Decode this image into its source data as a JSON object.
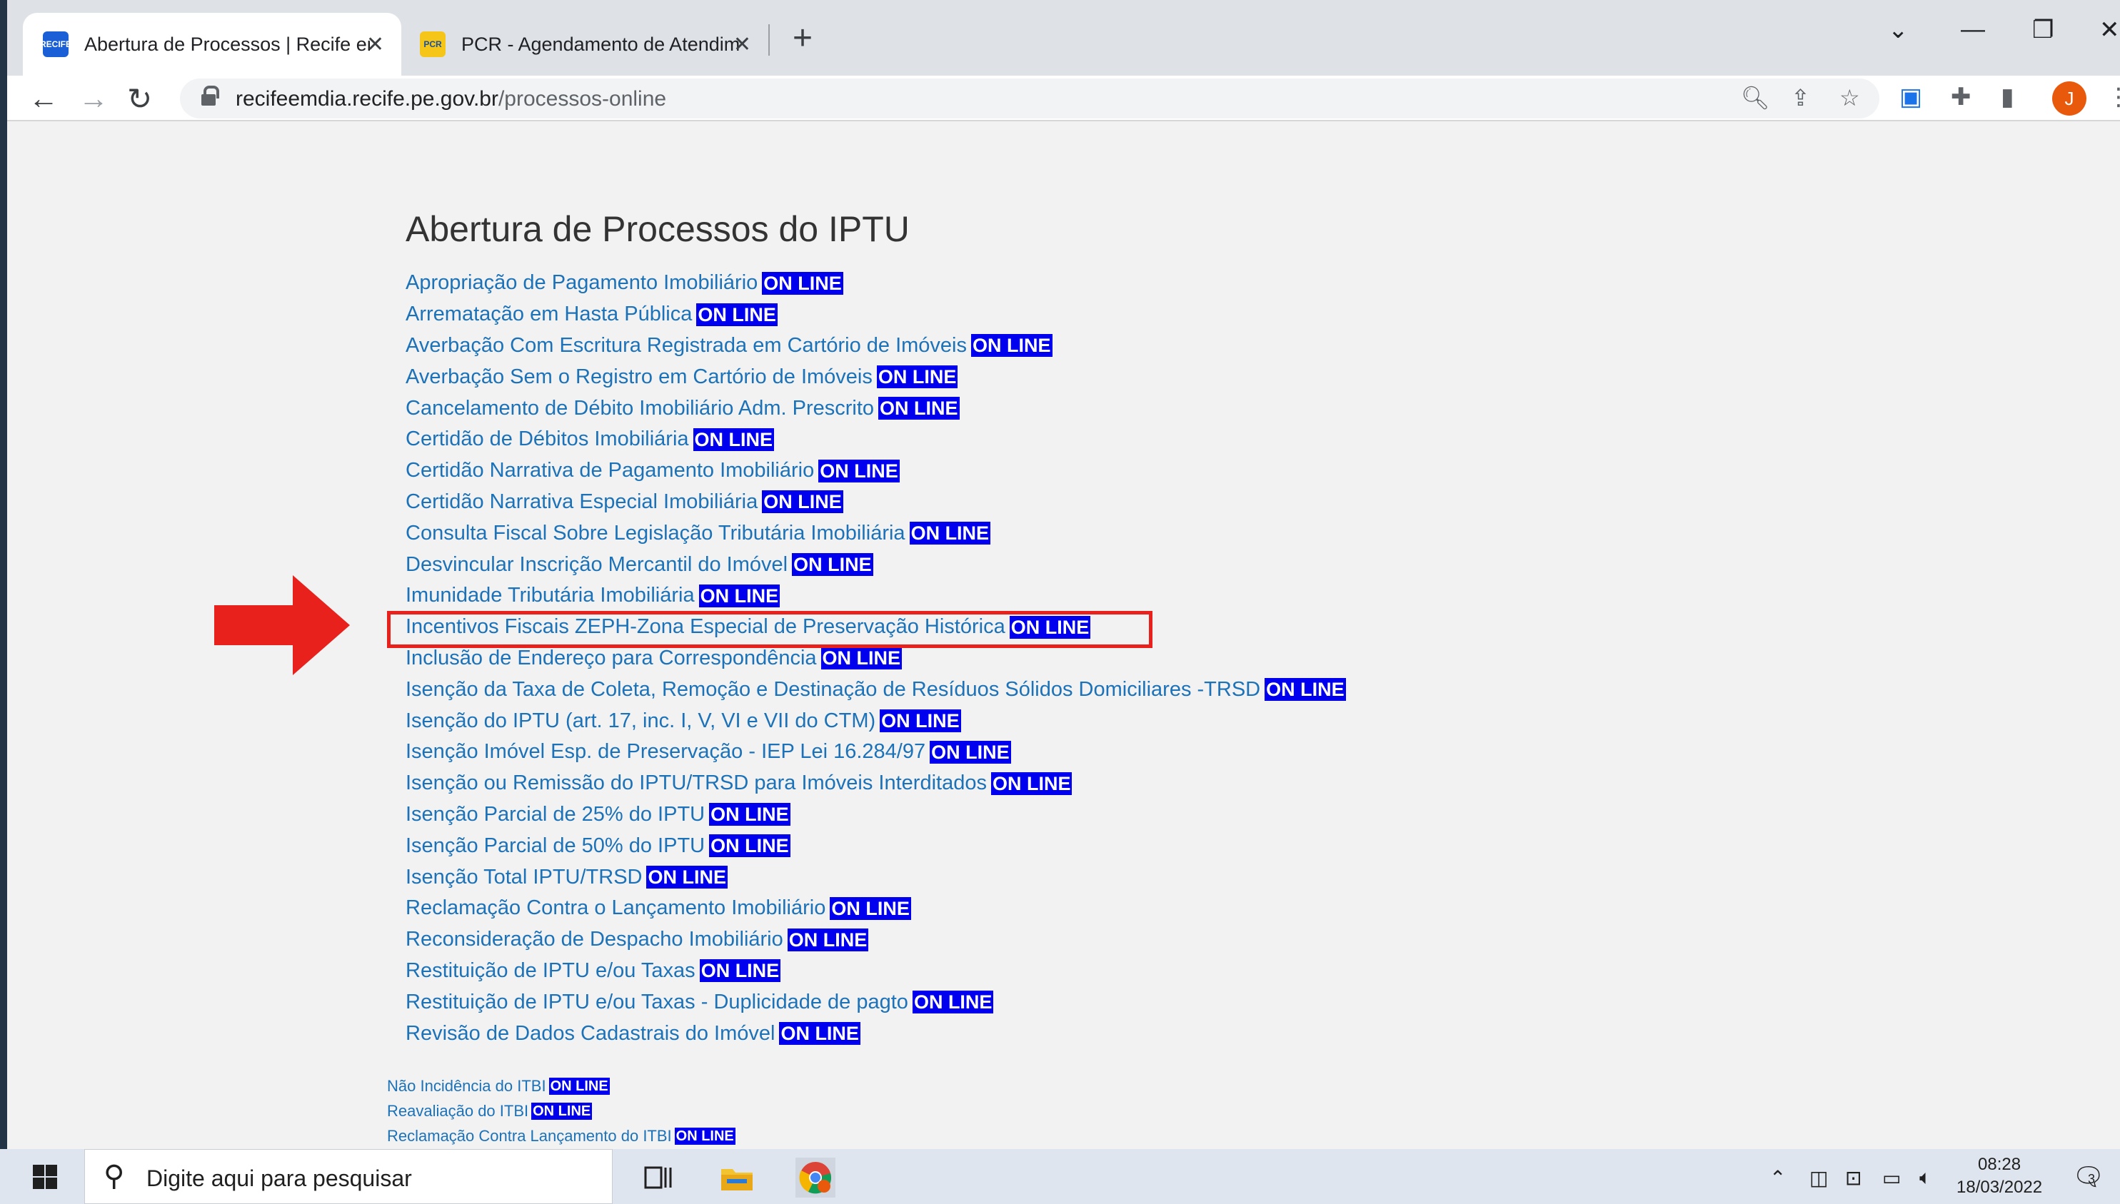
{
  "browser": {
    "tabs": [
      {
        "title": "Abertura de Processos | Recife em",
        "active": true,
        "icon": "recife-favicon"
      },
      {
        "title": "PCR - Agendamento de Atendim",
        "active": false,
        "icon": "pcr-favicon"
      }
    ],
    "url_host": "recifeemdia.recife.pe.gov.br",
    "url_path": "/processos-online",
    "profile_initial": "J"
  },
  "page": {
    "title": "Abertura de Processos do IPTU",
    "badge_label": "ON LINE",
    "iptu_items": [
      "Apropriação de Pagamento Imobiliário",
      "Arrematação em Hasta Pública",
      "Averbação Com Escritura Registrada em Cartório de Imóveis",
      "Averbação Sem o Registro em Cartório de Imóveis",
      "Cancelamento de Débito Imobiliário Adm. Prescrito",
      "Certidão de Débitos Imobiliária",
      "Certidão Narrativa de Pagamento Imobiliário",
      "Certidão Narrativa Especial Imobiliária",
      "Consulta Fiscal Sobre Legislação Tributária Imobiliária",
      "Desvincular Inscrição Mercantil do Imóvel",
      "Imunidade Tributária Imobiliária",
      "Incentivos Fiscais ZEPH-Zona Especial de Preservação Histórica",
      "Inclusão de Endereço para Correspondência",
      "Isenção da Taxa de Coleta, Remoção e Destinação de Resíduos Sólidos Domiciliares -TRSD",
      "Isenção do IPTU (art. 17, inc. I, V, VI e VII do CTM)",
      "Isenção Imóvel Esp. de Preservação - IEP Lei 16.284/97",
      "Isenção ou Remissão do IPTU/TRSD para Imóveis Interditados",
      "Isenção Parcial de 25% do IPTU",
      "Isenção Parcial de 50% do IPTU",
      "Isenção Total IPTU/TRSD",
      "Reclamação Contra o Lançamento Imobiliário",
      "Reconsideração de Despacho Imobiliário",
      "Restituição de IPTU e/ou Taxas",
      "Restituição de IPTU e/ou Taxas - Duplicidade de pagto",
      "Revisão de Dados Cadastrais do Imóvel"
    ],
    "itbi_items": [
      "Não Incidência do ITBI",
      "Reavaliação do ITBI",
      "Reclamação Contra Lançamento do ITBI"
    ],
    "highlighted_item": "Incentivos Fiscais ZEPH-Zona Especial de Preservação Histórica",
    "annotation_color": "#e8211c"
  },
  "taskbar": {
    "search_placeholder": "Digite aqui para pesquisar",
    "time": "08:28",
    "date": "18/03/2022",
    "notification_count": "3"
  }
}
